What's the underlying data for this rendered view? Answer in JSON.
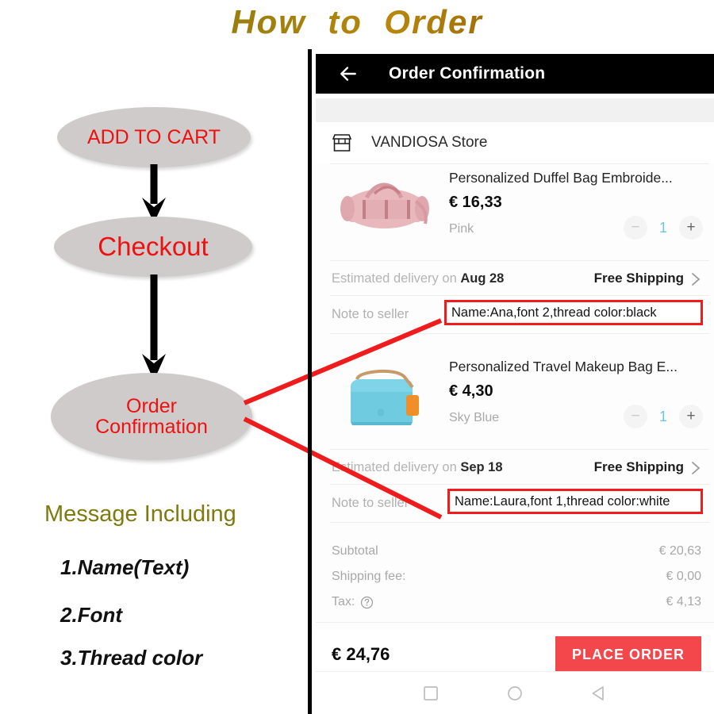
{
  "page": {
    "title": "How  to  Order"
  },
  "flow": {
    "steps": [
      {
        "label": "ADD TO CART"
      },
      {
        "label": "Checkout"
      },
      {
        "label_line1": "Order",
        "label_line2": "Confirmation"
      }
    ]
  },
  "message": {
    "heading": "Message Including",
    "items": [
      "1.Name(Text)",
      "2.Font",
      "3.Thread color"
    ]
  },
  "phone": {
    "appbar": {
      "back_icon": "back-arrow-icon",
      "title": "Order Confirmation"
    },
    "store": {
      "icon": "store-icon",
      "name": "VANDIOSA Store"
    },
    "items": [
      {
        "image": "pink-duffel-bag",
        "title": "Personalized Duffel Bag Embroide...",
        "price": "€ 16,33",
        "variant": "Pink",
        "qty": "1",
        "minus": "−",
        "plus": "+",
        "delivery_prefix": "Estimated delivery on ",
        "delivery_date": "Aug 28",
        "shipping": "Free Shipping",
        "note_label": "Note to seller",
        "note_value": "Name:Ana,font 2,thread color:black"
      },
      {
        "image": "sky-blue-makeup-bag",
        "title": "Personalized Travel Makeup Bag E...",
        "price": "€ 4,30",
        "variant": "Sky Blue",
        "qty": "1",
        "minus": "−",
        "plus": "+",
        "delivery_prefix": "Estimated delivery on ",
        "delivery_date": "Sep 18",
        "shipping": "Free Shipping",
        "note_label": "Note to seller",
        "note_value": "Name:Laura,font 1,thread color:white"
      }
    ],
    "totals": [
      {
        "label": "Subtotal",
        "value": "€ 20,63"
      },
      {
        "label": "Shipping fee:",
        "value": "€ 0,00"
      },
      {
        "label": "Tax:",
        "value": "€ 4,13",
        "help_icon": "question-circle-icon"
      }
    ],
    "grand_total": "€ 24,76",
    "place_order_label": "PLACE ORDER",
    "nav": [
      {
        "icon": "recents-square-icon"
      },
      {
        "icon": "home-circle-icon"
      },
      {
        "icon": "back-triangle-icon"
      }
    ]
  },
  "colors": {
    "title_gold": "#8a7a10",
    "ellipse_fill": "#cfcbcb",
    "ellipse_text_red": "#ee1111",
    "connector_red": "#ee1c1c",
    "place_order_red": "#f4474b",
    "qty_blue": "#6fc2e0",
    "message_olive": "#7f7a10"
  }
}
